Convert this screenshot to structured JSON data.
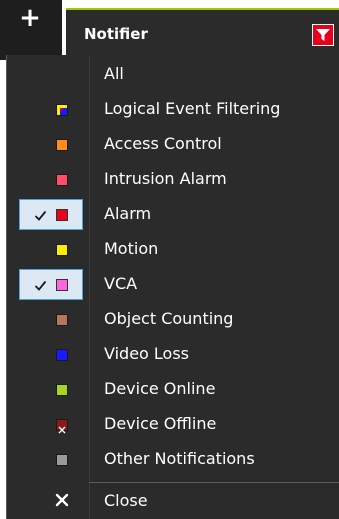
{
  "toolbar": {
    "plus_label": "+"
  },
  "header": {
    "title": "Notifier",
    "accent_color": "#9ccc00",
    "filter_icon": "filter-icon"
  },
  "menu": {
    "items": [
      {
        "label": "All",
        "color": null,
        "checked": false
      },
      {
        "label": "Logical Event Filtering",
        "color": "multi",
        "checked": false
      },
      {
        "label": "Access Control",
        "color": "#ff8c1a",
        "checked": false
      },
      {
        "label": "Intrusion Alarm",
        "color": "#ff4d6a",
        "checked": false
      },
      {
        "label": "Alarm",
        "color": "#e8001c",
        "checked": true
      },
      {
        "label": "Motion",
        "color": "#ffee00",
        "checked": false
      },
      {
        "label": "VCA",
        "color": "#ff66dd",
        "checked": true
      },
      {
        "label": "Object Counting",
        "color": "#b5775a",
        "checked": false
      },
      {
        "label": "Video Loss",
        "color": "#1a1aff",
        "checked": false
      },
      {
        "label": "Device Online",
        "color": "#a8d620",
        "checked": false
      },
      {
        "label": "Device Offline",
        "color": "#8b1a1a",
        "checked": false
      },
      {
        "label": "Other Notifications",
        "color": "#9a9a9a",
        "checked": false
      }
    ],
    "close_label": "Close"
  }
}
